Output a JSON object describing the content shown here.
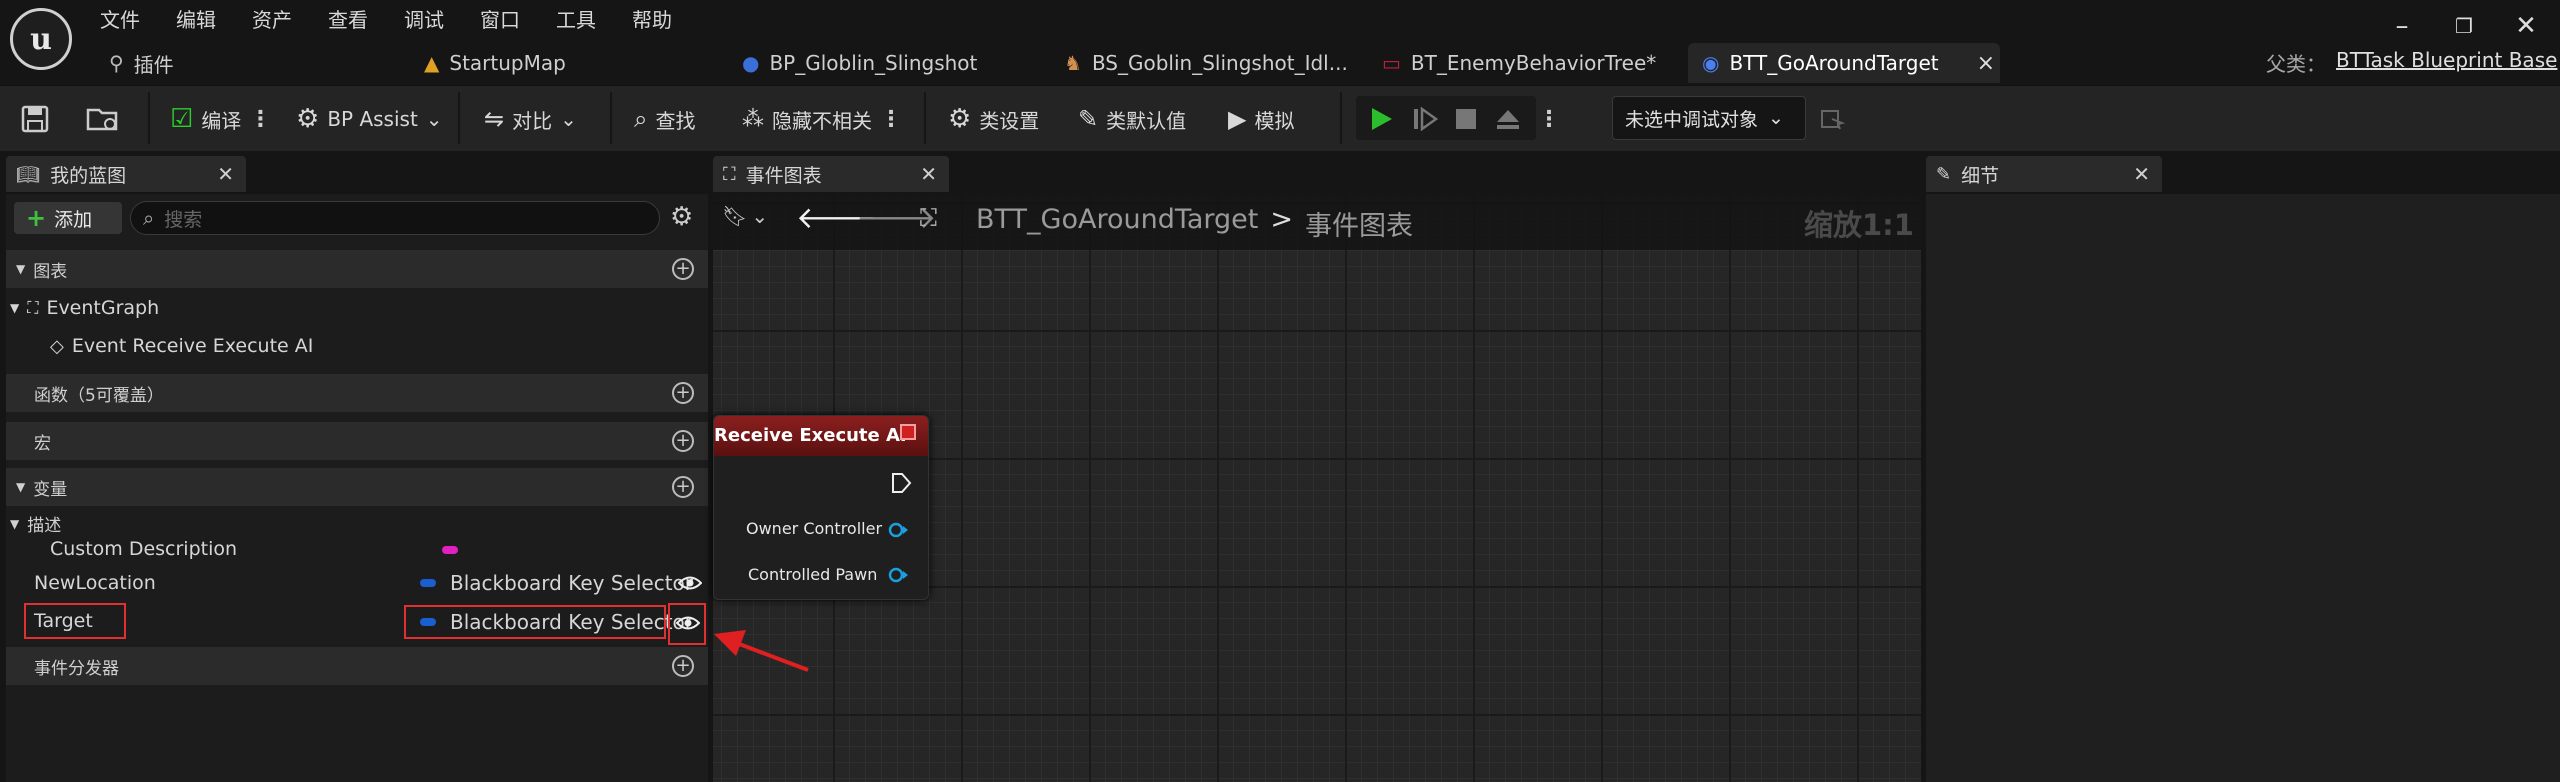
{
  "menu": [
    "文件",
    "编辑",
    "资产",
    "查看",
    "调试",
    "窗口",
    "工具",
    "帮助"
  ],
  "doc_tabs": [
    {
      "label": "插件"
    },
    {
      "label": "StartupMap"
    },
    {
      "label": "BP_Globlin_Slingshot"
    },
    {
      "label": "BS_Goblin_Slingshot_Idl..."
    },
    {
      "label": "BT_EnemyBehaviorTree*"
    },
    {
      "label": "BTT_GoAroundTarget",
      "close": "×"
    }
  ],
  "parent_class": {
    "label": "父类：",
    "value": "BTTask Blueprint Base"
  },
  "toolbar": {
    "compile": "编译",
    "bp_assist": "BP Assist",
    "diff": "对比",
    "find": "查找",
    "hide_unrelated": "隐藏不相关",
    "class_settings": "类设置",
    "class_defaults": "类默认值",
    "simulate": "模拟",
    "debug_target": "未选中调试对象"
  },
  "my_blueprint": {
    "tab_title": "我的蓝图",
    "add_label": "添加",
    "search_placeholder": "搜索",
    "cat_graphs": "图表",
    "event_graph": "EventGraph",
    "event_node": "Event Receive Execute AI",
    "cat_functions": "函数（5可覆盖）",
    "cat_macros": "宏",
    "cat_variables": "变量",
    "sub_description": "描述",
    "variables": [
      {
        "name": "Custom Description",
        "type": "",
        "color": "#e020c0"
      },
      {
        "name": "NewLocation",
        "type": "Blackboard Key Selector",
        "color": "#1a5fd0"
      },
      {
        "name": "Target",
        "type": "Blackboard Key Selector",
        "color": "#1a5fd0"
      }
    ],
    "cat_dispatchers": "事件分发器"
  },
  "event_graph": {
    "tab_title": "事件图表",
    "breadcrumb_bp": "BTT_GoAroundTarget",
    "breadcrumb_sep": ">",
    "breadcrumb_graph": "事件图表",
    "zoom": "缩放1:1",
    "node": {
      "title": "Receive Execute AI",
      "pins": [
        "Owner Controller",
        "Controlled Pawn"
      ]
    }
  },
  "details": {
    "tab_title": "细节"
  }
}
